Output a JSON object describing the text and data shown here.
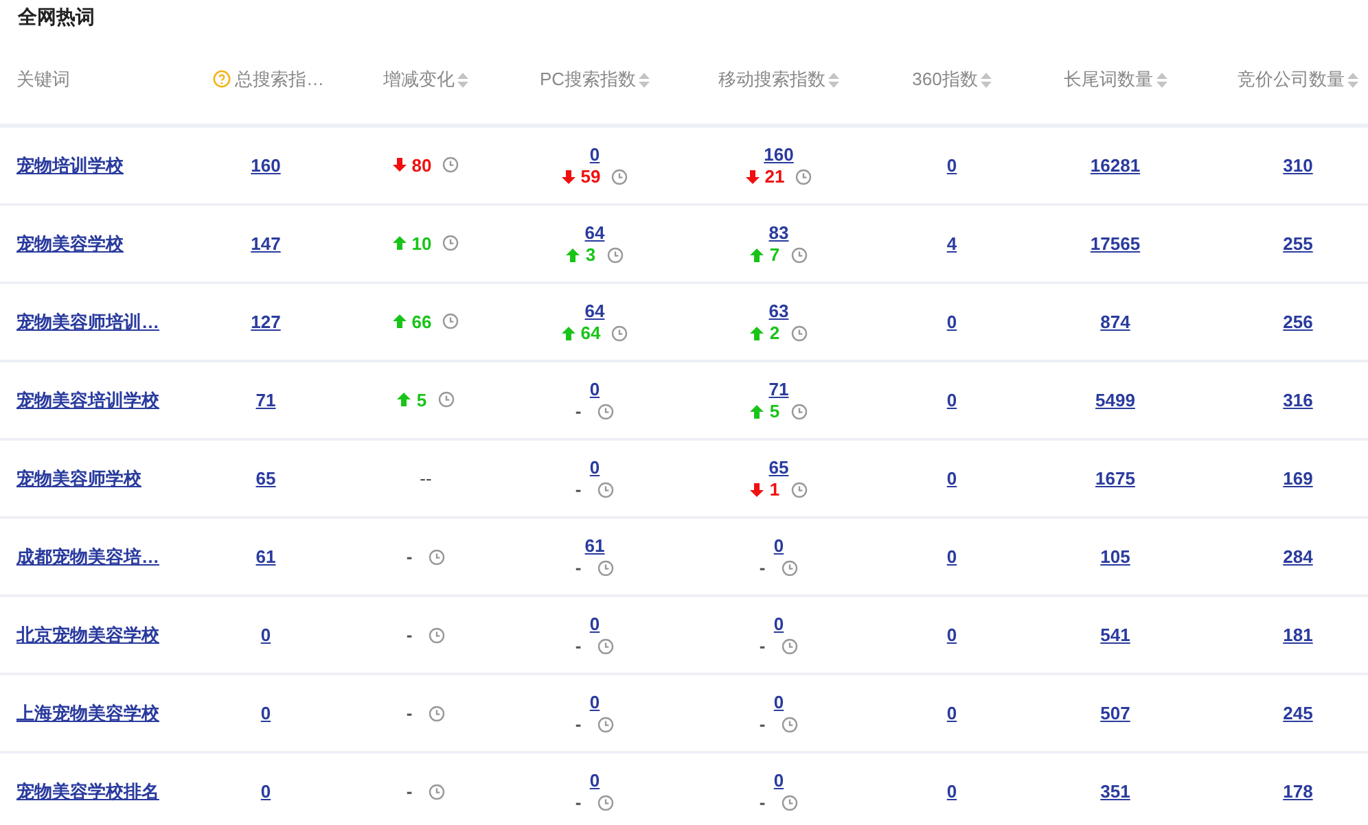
{
  "title": "全网热词",
  "columns": [
    {
      "label": "关键词",
      "sortable": false,
      "help": false
    },
    {
      "label": "总搜索指…",
      "sortable": false,
      "help": true
    },
    {
      "label": "增减变化",
      "sortable": true,
      "help": false
    },
    {
      "label": "PC搜索指数",
      "sortable": true,
      "help": false
    },
    {
      "label": "移动搜索指数",
      "sortable": true,
      "help": false
    },
    {
      "label": "360指数",
      "sortable": true,
      "help": false
    },
    {
      "label": "长尾词数量",
      "sortable": true,
      "help": false
    },
    {
      "label": "竞价公司数量",
      "sortable": true,
      "help": false
    }
  ],
  "rows": [
    {
      "keyword": "宠物培训学校",
      "total": "160",
      "change": {
        "kind": "down",
        "value": "80"
      },
      "pc": {
        "value": "0",
        "change": {
          "kind": "down",
          "value": "59"
        }
      },
      "mobile": {
        "value": "160",
        "change": {
          "kind": "down",
          "value": "21"
        }
      },
      "index_360": "0",
      "long_tail": "16281",
      "bidders": "310"
    },
    {
      "keyword": "宠物美容学校",
      "total": "147",
      "change": {
        "kind": "up",
        "value": "10"
      },
      "pc": {
        "value": "64",
        "change": {
          "kind": "up",
          "value": "3"
        }
      },
      "mobile": {
        "value": "83",
        "change": {
          "kind": "up",
          "value": "7"
        }
      },
      "index_360": "4",
      "long_tail": "17565",
      "bidders": "255"
    },
    {
      "keyword": "宠物美容师培训…",
      "total": "127",
      "change": {
        "kind": "up",
        "value": "66"
      },
      "pc": {
        "value": "64",
        "change": {
          "kind": "up",
          "value": "64"
        }
      },
      "mobile": {
        "value": "63",
        "change": {
          "kind": "up",
          "value": "2"
        }
      },
      "index_360": "0",
      "long_tail": "874",
      "bidders": "256"
    },
    {
      "keyword": "宠物美容培训学校",
      "total": "71",
      "change": {
        "kind": "up",
        "value": "5"
      },
      "pc": {
        "value": "0",
        "change": {
          "kind": "none",
          "value": "-"
        }
      },
      "mobile": {
        "value": "71",
        "change": {
          "kind": "up",
          "value": "5"
        }
      },
      "index_360": "0",
      "long_tail": "5499",
      "bidders": "316"
    },
    {
      "keyword": "宠物美容师学校",
      "total": "65",
      "change": {
        "kind": "plain",
        "value": "--"
      },
      "pc": {
        "value": "0",
        "change": {
          "kind": "none",
          "value": "-"
        }
      },
      "mobile": {
        "value": "65",
        "change": {
          "kind": "down",
          "value": "1"
        }
      },
      "index_360": "0",
      "long_tail": "1675",
      "bidders": "169"
    },
    {
      "keyword": "成都宠物美容培…",
      "total": "61",
      "change": {
        "kind": "none",
        "value": "-"
      },
      "pc": {
        "value": "61",
        "change": {
          "kind": "none",
          "value": "-"
        }
      },
      "mobile": {
        "value": "0",
        "change": {
          "kind": "none",
          "value": "-"
        }
      },
      "index_360": "0",
      "long_tail": "105",
      "bidders": "284"
    },
    {
      "keyword": "北京宠物美容学校",
      "total": "0",
      "change": {
        "kind": "none",
        "value": "-"
      },
      "pc": {
        "value": "0",
        "change": {
          "kind": "none",
          "value": "-"
        }
      },
      "mobile": {
        "value": "0",
        "change": {
          "kind": "none",
          "value": "-"
        }
      },
      "index_360": "0",
      "long_tail": "541",
      "bidders": "181"
    },
    {
      "keyword": "上海宠物美容学校",
      "total": "0",
      "change": {
        "kind": "none",
        "value": "-"
      },
      "pc": {
        "value": "0",
        "change": {
          "kind": "none",
          "value": "-"
        }
      },
      "mobile": {
        "value": "0",
        "change": {
          "kind": "none",
          "value": "-"
        }
      },
      "index_360": "0",
      "long_tail": "507",
      "bidders": "245"
    },
    {
      "keyword": "宠物美容学校排名",
      "total": "0",
      "change": {
        "kind": "none",
        "value": "-"
      },
      "pc": {
        "value": "0",
        "change": {
          "kind": "none",
          "value": "-"
        }
      },
      "mobile": {
        "value": "0",
        "change": {
          "kind": "none",
          "value": "-"
        }
      },
      "index_360": "0",
      "long_tail": "351",
      "bidders": "178"
    }
  ]
}
